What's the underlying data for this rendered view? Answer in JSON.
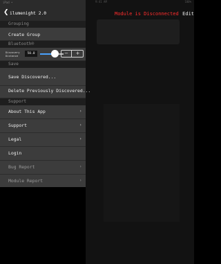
{
  "status_bar": {
    "left": "iPad •",
    "center": "9:41 AM",
    "right": "100%"
  },
  "main": {
    "title": "Module is Disconnected",
    "edit_label": "Edit",
    "title_color": "#ff2d2d"
  },
  "sidebar": {
    "back_icon": "chevron-left-icon",
    "title": "ilumenight 2.0",
    "sections": {
      "grouping": "Grouping",
      "bluetooth": "Bluetooth®",
      "save": "Save",
      "support": "Support"
    },
    "grouping_items": [
      {
        "label": "Create Group"
      }
    ],
    "bluetooth": {
      "discovery_label_line1": "Discovery",
      "discovery_label_line2": "Distance",
      "discovery_value": "50.0",
      "slider_fraction": 0.6,
      "stepper_minus": "−",
      "stepper_plus": "+"
    },
    "save_items": [
      {
        "label": "Save Discovered..."
      },
      {
        "label": "Delete Previously Discovered..."
      }
    ],
    "support_items": [
      {
        "label": "About This App",
        "chevron": "›"
      },
      {
        "label": "Support",
        "chevron": "›"
      },
      {
        "label": "Legal",
        "chevron": "›"
      },
      {
        "label": "Login"
      },
      {
        "label": "Bug Report",
        "chevron": "›"
      },
      {
        "label": "Module Report",
        "chevron": "›"
      }
    ],
    "accent_color": "#4aa3ff"
  }
}
